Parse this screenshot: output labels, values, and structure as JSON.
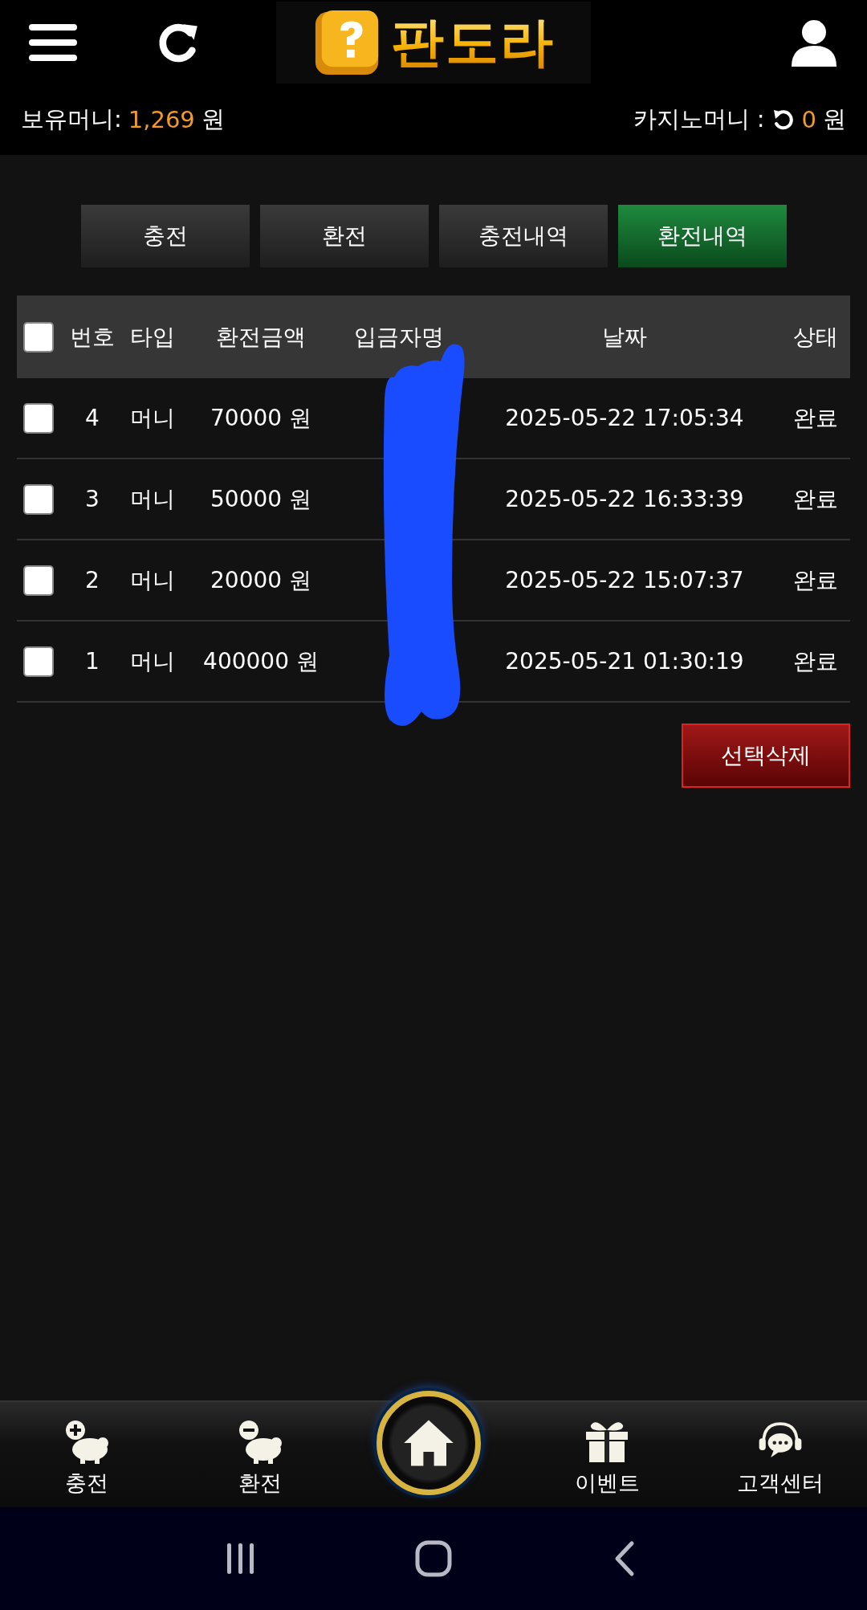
{
  "header": {
    "logo": "판도라"
  },
  "balances": [
    {
      "label": "보유머니:",
      "value": "1,269",
      "unit": "원",
      "refresh": false
    },
    {
      "label": "카지노머니 :",
      "value": "0",
      "unit": "원",
      "refresh": true
    }
  ],
  "tabs": [
    {
      "label": "충전",
      "selected": false
    },
    {
      "label": "환전",
      "selected": false
    },
    {
      "label": "충전내역",
      "selected": false
    },
    {
      "label": "환전내역",
      "selected": true
    }
  ],
  "table": {
    "select_all_checked": false,
    "columns": [
      "번호",
      "타입",
      "환전금액",
      "입금자명",
      "날짜",
      "상태"
    ],
    "rows": [
      {
        "checked": false,
        "cells": [
          "4",
          "머니",
          "70000 원",
          "",
          "2025-05-22 17:05:34",
          "완료"
        ]
      },
      {
        "checked": false,
        "cells": [
          "3",
          "머니",
          "50000 원",
          "",
          "2025-05-22 16:33:39",
          "완료"
        ]
      },
      {
        "checked": false,
        "cells": [
          "2",
          "머니",
          "20000 원",
          "",
          "2025-05-22 15:07:37",
          "완료"
        ]
      },
      {
        "checked": false,
        "cells": [
          "1",
          "머니",
          "400000 원",
          "",
          "2025-05-21 01:30:19",
          "완료"
        ]
      }
    ]
  },
  "delete_button": "선택삭제",
  "bottom_nav": [
    {
      "kind": "plus",
      "label": "충전"
    },
    {
      "kind": "minus",
      "label": "환전"
    },
    {
      "kind": "home"
    },
    {
      "kind": "gift",
      "label": "이벤트"
    },
    {
      "kind": "support",
      "label": "고객센터"
    }
  ]
}
